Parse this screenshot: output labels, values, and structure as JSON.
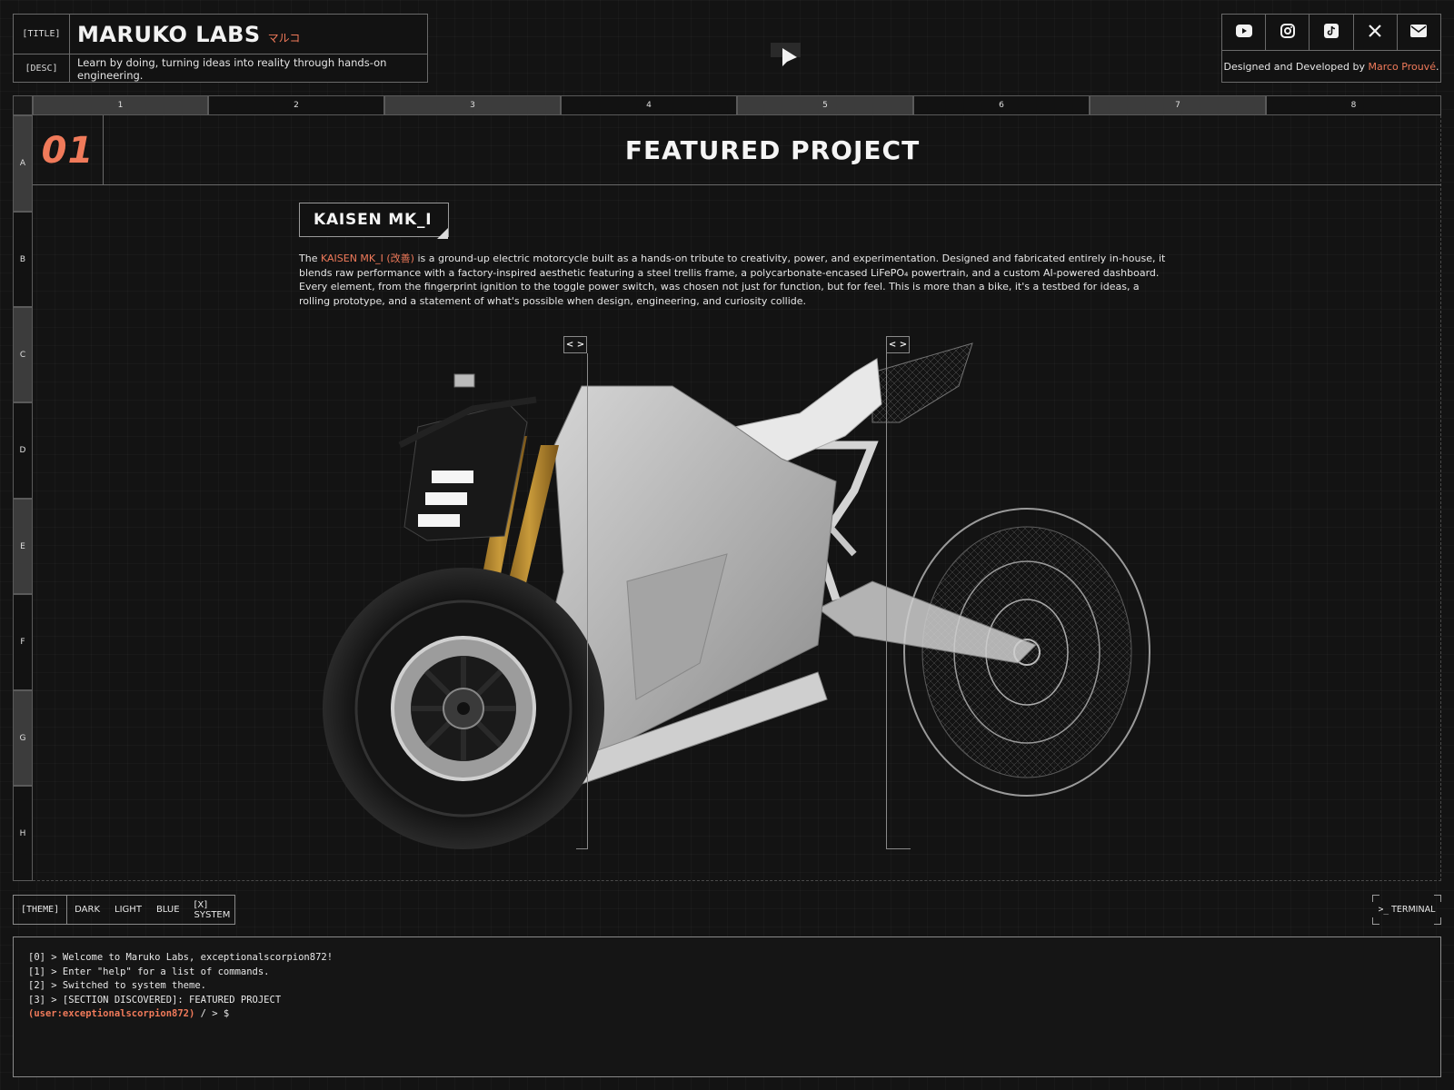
{
  "header": {
    "title_label": "[TITLE]",
    "title": "MARUKO LABS",
    "title_jp": "マルコ",
    "desc_label": "[DESC]",
    "desc": "Learn by doing, turning ideas into reality through hands-on engineering."
  },
  "social": {
    "items": [
      {
        "name": "youtube-icon"
      },
      {
        "name": "instagram-icon"
      },
      {
        "name": "tiktok-icon"
      },
      {
        "name": "x-icon"
      },
      {
        "name": "mail-icon"
      }
    ],
    "credit_prefix": "Designed and Developed by ",
    "credit_name": "Marco Prouvé",
    "credit_suffix": "."
  },
  "grid": {
    "columns": [
      "1",
      "2",
      "3",
      "4",
      "5",
      "6",
      "7",
      "8"
    ],
    "rows": [
      "A",
      "B",
      "C",
      "D",
      "E",
      "F",
      "G",
      "H"
    ]
  },
  "section": {
    "number": "01",
    "title": "FEATURED PROJECT"
  },
  "project": {
    "name": "KAISEN MK_I",
    "desc_pre": "The ",
    "desc_highlight": "KAISEN MK_I (改善)",
    "desc_post": " is a ground-up electric motorcycle built as a hands-on tribute to creativity, power, and experimentation. Designed and fabricated entirely in-house, it blends raw performance with a factory-inspired aesthetic featuring a steel trellis frame, a polycarbonate-encased LiFePO₄ powertrain, and a custom AI-powered dashboard. Every element, from the fingerprint ignition to the toggle power switch, was chosen not just for function, but for feel. This is more than a bike, it's a testbed for ideas, a rolling prototype, and a statement of what's possible when design, engineering, and curiosity collide.",
    "handle_label": "< >"
  },
  "theme": {
    "label": "[THEME]",
    "options": [
      "DARK",
      "LIGHT",
      "BLUE",
      "[X] SYSTEM"
    ]
  },
  "terminal": {
    "button_label": "TERMINAL",
    "button_glyph": ">_",
    "lines": [
      "[0] > Welcome to Maruko Labs, exceptionalscorpion872!",
      "[1] > Enter \"help\" for a list of commands.",
      "[2] > Switched to system theme.",
      "[3] > [SECTION DISCOVERED]: FEATURED PROJECT"
    ],
    "prompt_user": "(user:exceptionalscorpion872)",
    "prompt_path": " / > $"
  },
  "colors": {
    "accent": "#f07a5a",
    "background": "#131313",
    "border": "#6a6a6a"
  }
}
